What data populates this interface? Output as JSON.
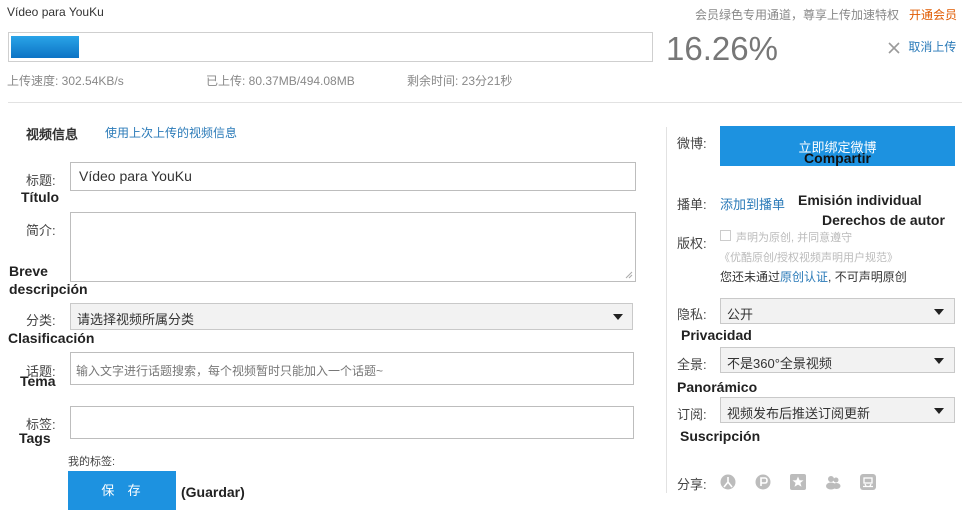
{
  "upload": {
    "title": "Vídeo para YouKu",
    "vip_text": "会员绿色专用通道，尊享上传加速特权",
    "vip_link": "开通会员",
    "percent": "16.26%",
    "progress": 0.1626,
    "cancel": "取消上传",
    "speed": "上传速度: 302.54KB/s",
    "uploaded": "已上传: 80.37MB/494.08MB",
    "remaining": "剩余时间: 23分21秒"
  },
  "form": {
    "section_title": "视频信息",
    "reuse_link": "使用上次上传的视频信息",
    "title_label": "标题:",
    "title_trans": "Título",
    "title_value": "Vídeo para YouKu",
    "desc_label": "简介:",
    "desc_trans_1": "Breve",
    "desc_trans_2": "descripción",
    "category_label": "分类:",
    "category_trans": "Clasificación",
    "category_value": "请选择视频所属分类",
    "topic_label": "话题:",
    "topic_trans": "Tema",
    "topic_placeholder": "输入文字进行话题搜索，每个视频暂时只能加入一个话题~",
    "tags_label": "标签:",
    "tags_trans": "Tags",
    "my_tags": "我的标签:",
    "save_label": "保  存",
    "save_trans": "(Guardar)"
  },
  "side": {
    "weibo_label": "微博:",
    "weibo_button": "立即绑定微博",
    "weibo_trans": "Compartir",
    "playlist_label": "播单:",
    "playlist_link": "添加到播单",
    "playlist_trans": "Emisión individual",
    "copyright_trans": "Derechos de autor",
    "copyright_label": "版权:",
    "copyright_check": "声明为原创, 并同意遵守",
    "copyright_rule": "《优酷原创/授权视频声明用户规范》",
    "copyright_note_pre": "您还未通过",
    "copyright_note_link": "原创认证",
    "copyright_note_post": ", 不可声明原创",
    "privacy_label": "隐私:",
    "privacy_value": "公开",
    "privacy_trans": "Privacidad",
    "panorama_label": "全景:",
    "panorama_value": "不是360°全景视频",
    "panorama_trans": "Panorámico",
    "subscribe_label": "订阅:",
    "subscribe_value": "视频发布后推送订阅更新",
    "subscribe_trans": "Suscripción",
    "share_label": "分享:"
  },
  "colors": {
    "accent": "#1d92e0",
    "link": "#2a7ab8",
    "vip": "#e05a00"
  }
}
